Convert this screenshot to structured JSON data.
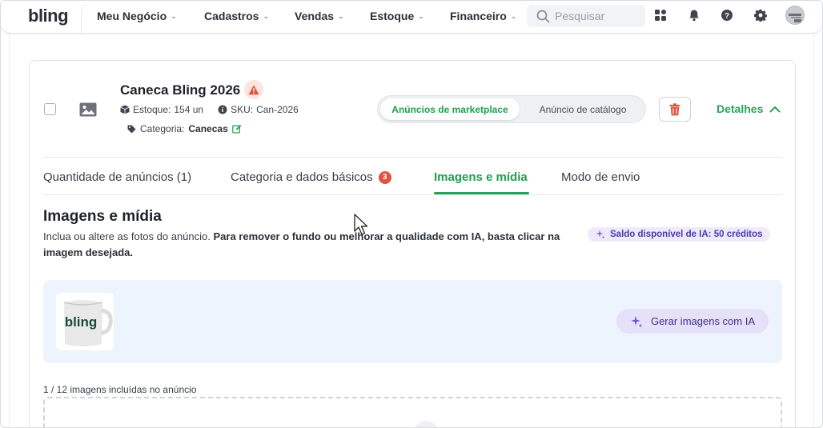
{
  "app": {
    "logo": "bling"
  },
  "nav": {
    "items": [
      {
        "label": "Meu Negócio"
      },
      {
        "label": "Cadastros"
      },
      {
        "label": "Vendas"
      },
      {
        "label": "Estoque"
      },
      {
        "label": "Financeiro"
      }
    ],
    "search_placeholder": "Pesquisar",
    "icons": [
      "apps-icon",
      "bell-icon",
      "help-icon",
      "gear-icon",
      "avatar"
    ]
  },
  "product": {
    "title": "Caneca Bling 2026",
    "stock_label": "Estoque:",
    "stock_value": "154 un",
    "sku_label": "SKU:",
    "sku_value": "Can-2026",
    "category_label": "Categoria:",
    "category_value": "Canecas"
  },
  "listing_toggle": {
    "active": "Anúncios de marketplace",
    "inactive": "Anúncio de catálogo"
  },
  "details_label": "Detalhes",
  "tabs": [
    {
      "label": "Quantidade de anúncios (1)"
    },
    {
      "label": "Categoria e dados básicos",
      "count": "3"
    },
    {
      "label": "Imagens e mídia"
    },
    {
      "label": "Modo de envio"
    }
  ],
  "section": {
    "title": "Imagens e mídia",
    "desc_normal": "Inclua ou altere as fotos do anúncio.",
    "desc_bold": "Para remover o fundo ou melhorar a qualidade com IA, basta clicar na imagem desejada.",
    "ai_credit": "Saldo disponível de IA: 50 créditos",
    "thumb_text": "bling",
    "ai_generate": "Gerar imagens com IA",
    "image_count": "1 / 12 imagens incluídas no anúncio"
  },
  "colors": {
    "accent_green": "#2aa35a",
    "warning_red": "#e0533d",
    "ai_purple": "#4a3aa8",
    "media_bg": "#eef4fe"
  }
}
